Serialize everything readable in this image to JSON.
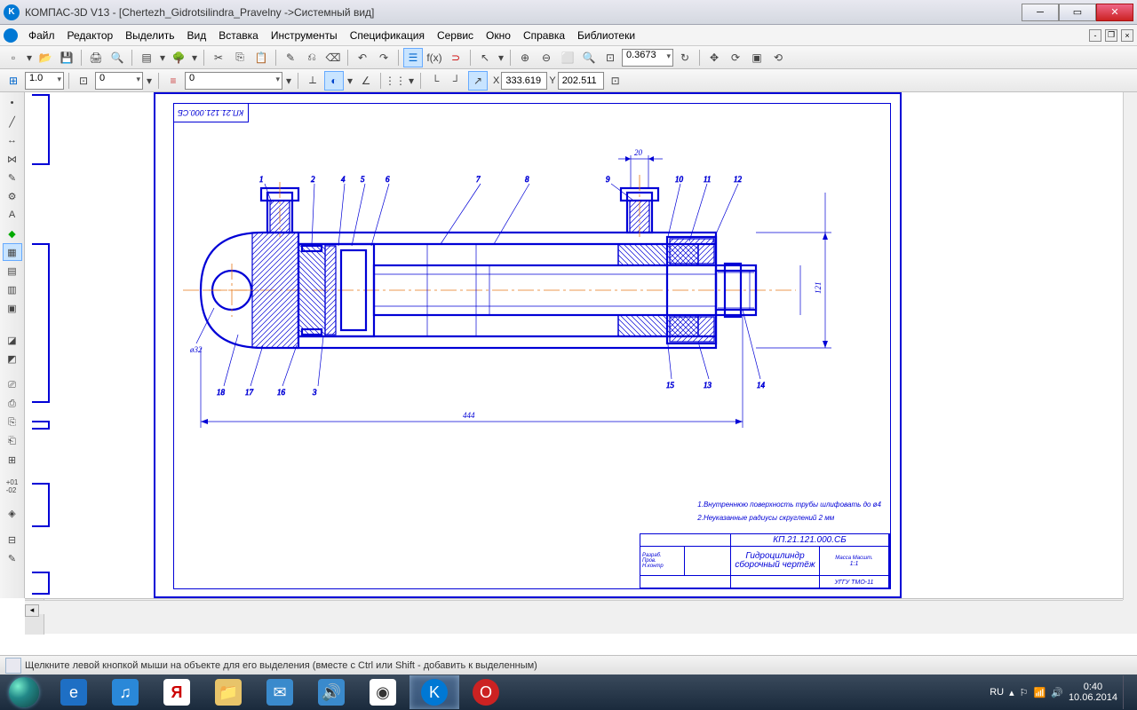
{
  "title": "КОМПАС-3D V13 - [Chertezh_Gidrotsilindra_Pravelny ->Системный вид]",
  "menu": [
    "Файл",
    "Редактор",
    "Выделить",
    "Вид",
    "Вставка",
    "Инструменты",
    "Спецификация",
    "Сервис",
    "Окно",
    "Справка",
    "Библиотеки"
  ],
  "toolbar2": {
    "zoom": "0.3673"
  },
  "toolbar3": {
    "step": "1.0",
    "style": "0",
    "layer": "0",
    "coordX": "333.619",
    "coordY": "202.511",
    "xlabel": "X",
    "ylabel": "Y"
  },
  "drawing": {
    "code_top": "КП.21.121.000.СБ",
    "note1": "1.Внутреннюю поверхность трубы шлифовать до ø4",
    "note2": "2.Неуказанные радиусы скруглений 2 мм",
    "tb_code": "КП.21.121.000.СБ",
    "tb_name": "Гидроцилиндр",
    "tb_sub": "сборочный чертёж",
    "tb_scale": "1:1",
    "tb_org": "УГГУ ТМО-11",
    "dims": {
      "len": "444",
      "h": "121",
      "port": "20",
      "diam": "ø32"
    },
    "balloons": [
      "1",
      "2",
      "4",
      "5",
      "6",
      "7",
      "8",
      "9",
      "10",
      "11",
      "12",
      "18",
      "17",
      "16",
      "3",
      "15",
      "13",
      "14"
    ]
  },
  "status": "Щелкните левой кнопкой мыши на объекте для его выделения (вместе с Ctrl или Shift - добавить к выделенным)",
  "tray": {
    "lang": "RU",
    "time": "0:40",
    "date": "10.06.2014"
  }
}
